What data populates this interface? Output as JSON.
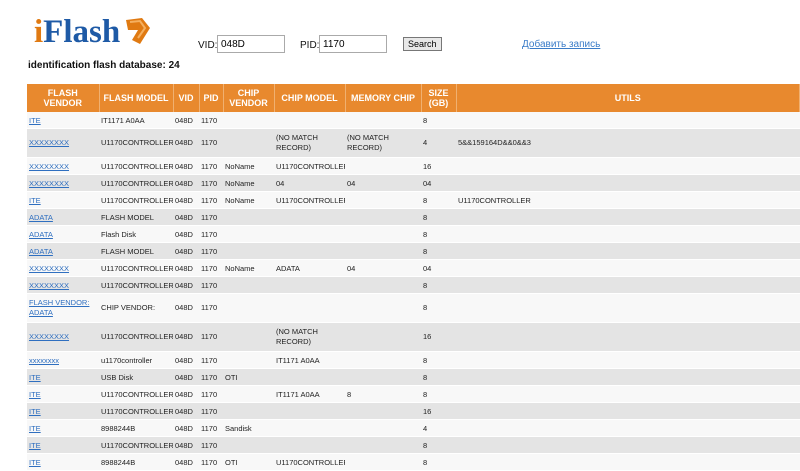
{
  "header": {
    "logo_i": "i",
    "logo_rest": "Flash",
    "db_count": "identification flash database: 24",
    "vid_label": "VID:",
    "vid_value": "048D",
    "pid_label": "PID:",
    "pid_value": "1170",
    "search_label": "Search",
    "add_record": "Добавить запись"
  },
  "colors": {
    "accent": "#e8892e",
    "link": "#2f6fc0"
  },
  "columns": [
    "FLASH VENDOR",
    "FLASH MODEL",
    "VID",
    "PID",
    "CHIP VENDOR",
    "CHIP MODEL",
    "MEMORY CHIP",
    "SIZE (GB)",
    "UTILS"
  ],
  "rows": [
    [
      "ITE",
      "IT1171 A0AA",
      "048D",
      "1170",
      "",
      "",
      "",
      "8",
      ""
    ],
    [
      "XXXXXXXX",
      "U1170CONTROLLER",
      "048D",
      "1170",
      "",
      "(NO MATCH RECORD)",
      "(NO MATCH RECORD)",
      "4",
      "5&&159164D&&0&&3"
    ],
    [
      "XXXXXXXX",
      "U1170CONTROLLER",
      "048D",
      "1170",
      "NoName",
      "U1170CONTROLLER",
      "",
      "16",
      ""
    ],
    [
      "XXXXXXXX",
      "U1170CONTROLLER",
      "048D",
      "1170",
      "NoName",
      "04",
      "04",
      "04",
      ""
    ],
    [
      "ITE",
      "U1170CONTROLLER",
      "048D",
      "1170",
      "NoName",
      "U1170CONTROLLER",
      "",
      "8",
      "U1170CONTROLLER"
    ],
    [
      "ADATA",
      "FLASH MODEL",
      "048D",
      "1170",
      "",
      "",
      "",
      "8",
      ""
    ],
    [
      "ADATA",
      "Flash Disk",
      "048D",
      "1170",
      "",
      "",
      "",
      "8",
      ""
    ],
    [
      "ADATA",
      "FLASH MODEL",
      "048D",
      "1170",
      "",
      "",
      "",
      "8",
      ""
    ],
    [
      "XXXXXXXX",
      "U1170CONTROLLER",
      "048D",
      "1170",
      "NoName",
      "ADATA",
      "04",
      "04",
      ""
    ],
    [
      "XXXXXXXX",
      "U1170CONTROLLER",
      "048D",
      "1170",
      "",
      "",
      "",
      "8",
      ""
    ],
    [
      "FLASH VENDOR: ADATA",
      "CHIP VENDOR:",
      "048D",
      "1170",
      "",
      "",
      "",
      "8",
      ""
    ],
    [
      "XXXXXXXX",
      "U1170CONTROLLER",
      "048D",
      "1170",
      "",
      "(NO MATCH RECORD)",
      "",
      "16",
      ""
    ],
    [
      "xxxxxxxx",
      "u1170controller",
      "048D",
      "1170",
      "",
      "IT1171 A0AA",
      "",
      "8",
      ""
    ],
    [
      "ITE",
      "USB Disk",
      "048D",
      "1170",
      "OTI",
      "",
      "",
      "8",
      ""
    ],
    [
      "ITE",
      "U1170CONTROLLER",
      "048D",
      "1170",
      "",
      "IT1171 A0AA",
      "8",
      "8",
      ""
    ],
    [
      "ITE",
      "U1170CONTROLLER",
      "048D",
      "1170",
      "",
      "",
      "",
      "16",
      ""
    ],
    [
      "ITE",
      "8988244B",
      "048D",
      "1170",
      "Sandisk",
      "",
      "",
      "4",
      ""
    ],
    [
      "ITE",
      "U1170CONTROLLER",
      "048D",
      "1170",
      "",
      "",
      "",
      "8",
      ""
    ],
    [
      "ITE",
      "8988244B",
      "048D",
      "1170",
      "OTI",
      "U1170CONTROLLER",
      "",
      "8",
      ""
    ]
  ]
}
